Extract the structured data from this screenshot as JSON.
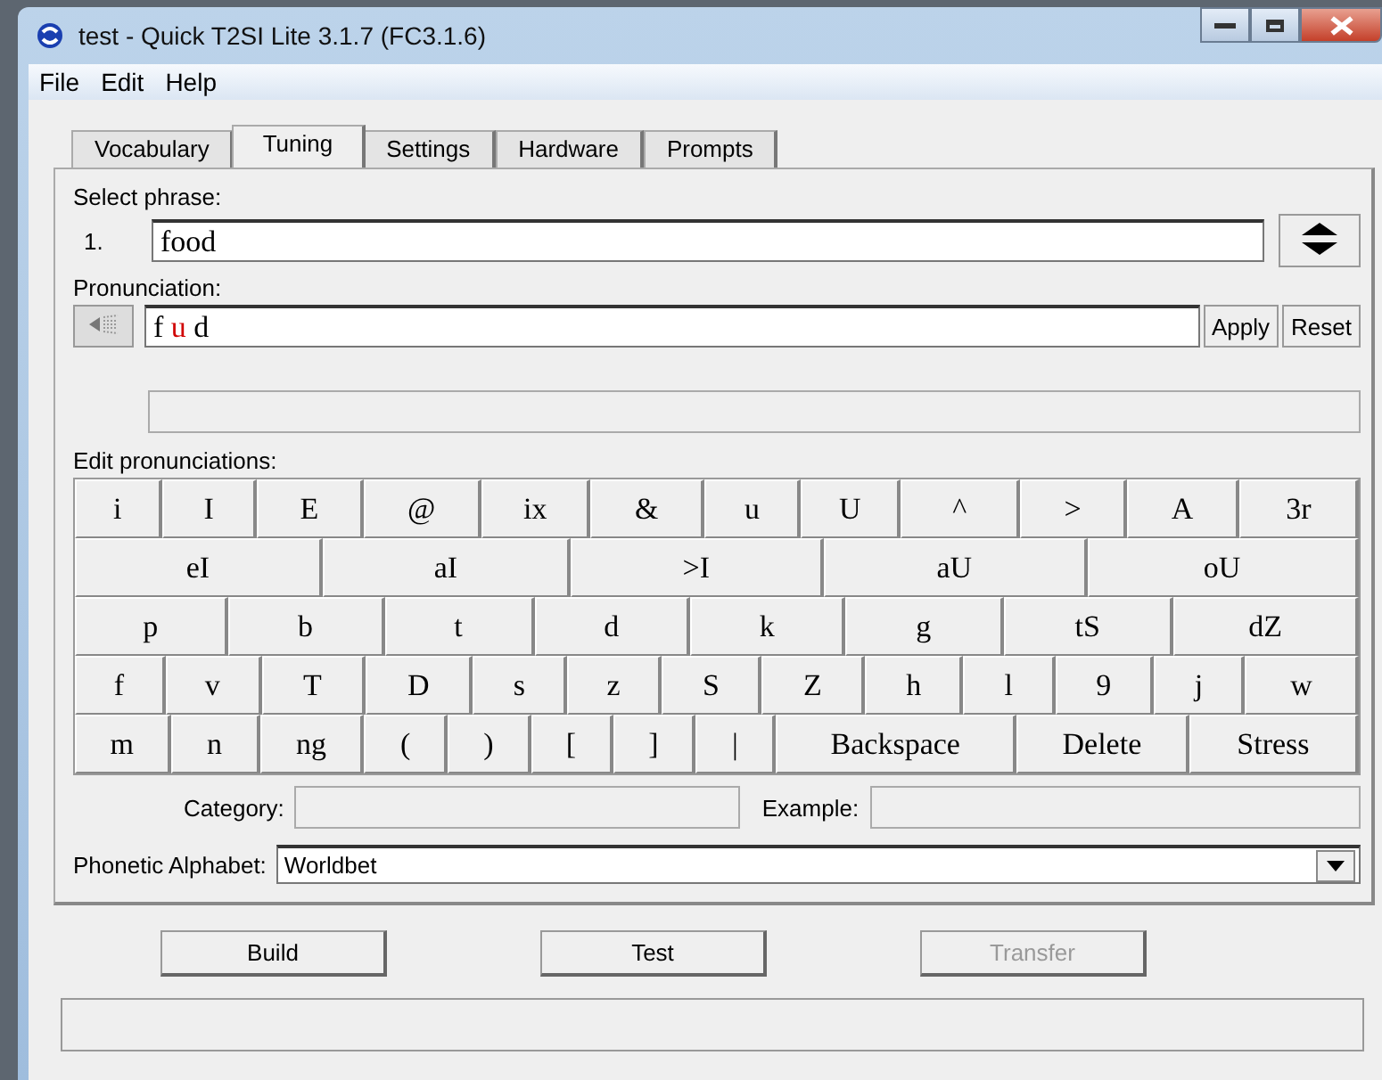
{
  "window": {
    "title": "test - Quick T2SI Lite 3.1.7 (FC3.1.6)"
  },
  "menu": [
    "File",
    "Edit",
    "Help"
  ],
  "tabs": [
    {
      "label": "Vocabulary",
      "selected": false
    },
    {
      "label": "Tuning",
      "selected": true
    },
    {
      "label": "Settings",
      "selected": false
    },
    {
      "label": "Hardware",
      "selected": false
    },
    {
      "label": "Prompts",
      "selected": false
    }
  ],
  "select_phrase": {
    "label": "Select phrase:",
    "index": "1.",
    "value": "food"
  },
  "pronunciation": {
    "label": "Pronunciation:",
    "segments": [
      {
        "text": "f",
        "highlighted": false
      },
      {
        "text": "u",
        "highlighted": true
      },
      {
        "text": "d",
        "highlighted": false
      }
    ],
    "buttons": [
      "Apply",
      "Reset"
    ]
  },
  "edit_pronunciations": {
    "label": "Edit pronunciations:",
    "key_rows": [
      {
        "keys": [
          "i",
          "I",
          "E",
          "@",
          "ix",
          "&",
          "u",
          "U",
          "^",
          ">",
          "A",
          "3r"
        ]
      },
      {
        "keys": [
          "eI",
          "aI",
          ">I",
          "aU",
          "oU"
        ]
      },
      {
        "keys": [
          "p",
          "b",
          "t",
          "d",
          "k",
          "g",
          "tS",
          "dZ"
        ]
      },
      {
        "keys": [
          "f",
          "v",
          "T",
          "D",
          "s",
          "z",
          "S",
          "Z",
          "h",
          "l",
          "9",
          "j",
          "w"
        ]
      },
      {
        "keys": [
          "m",
          "n",
          "ng",
          "(",
          ")",
          "[",
          "]",
          "|",
          "Backspace",
          "Delete",
          "Stress"
        ]
      }
    ]
  },
  "category": {
    "label": "Category:"
  },
  "example": {
    "label": "Example:"
  },
  "phonetic_alphabet": {
    "label": "Phonetic Alphabet:",
    "value": "Worldbet"
  },
  "buttons": [
    {
      "label": "Build",
      "disabled": false
    },
    {
      "label": "Test",
      "disabled": false
    },
    {
      "label": "Transfer",
      "disabled": true
    }
  ]
}
